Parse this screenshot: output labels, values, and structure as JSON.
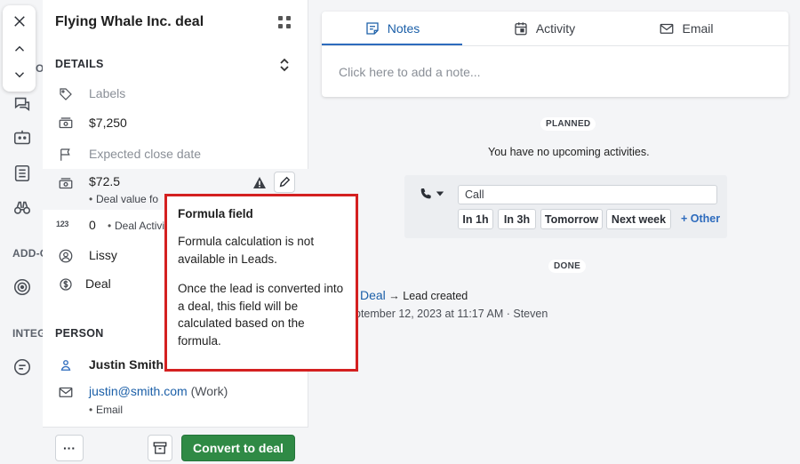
{
  "rail": {
    "addons_label": "ADD-ONS",
    "integrations_label": "INTEGRATIONS",
    "partial_label": "O"
  },
  "deal": {
    "title": "Flying Whale Inc. deal",
    "details_heading": "DETAILS",
    "labels_placeholder": "Labels",
    "value": "$7,250",
    "close_date_placeholder": "Expected close date",
    "formula_value": "$72.5",
    "formula_sub": "Deal value fo",
    "count_value": "0",
    "count_sub": "Deal Activi",
    "owner": "Lissy",
    "pipeline": "Deal"
  },
  "person": {
    "heading": "PERSON",
    "name": "Justin Smith",
    "email": "justin@smith.com",
    "email_type": "(Work)",
    "email_sub": "Email"
  },
  "footer": {
    "more_label": "···",
    "convert_label": "Convert to deal"
  },
  "tooltip": {
    "title": "Formula field",
    "p1": "Formula calculation is not available in Leads.",
    "p2": "Once the lead is converted into a deal, this field will be calculated based on the formula."
  },
  "tabs": [
    {
      "label": "Notes",
      "icon": "note-icon",
      "active": true
    },
    {
      "label": "Activity",
      "icon": "calendar-icon",
      "active": false
    },
    {
      "label": "Email",
      "icon": "envelope-icon",
      "active": false
    }
  ],
  "notes": {
    "placeholder": "Click here to add a note..."
  },
  "activity": {
    "planned_badge": "PLANNED",
    "no_activities": "You have no upcoming activities.",
    "input_value": "Call",
    "chips": [
      "In 1h",
      "In 3h",
      "Tomorrow",
      "Next week"
    ],
    "other_label": "+ Other",
    "done_badge": "DONE"
  },
  "history": {
    "link": "Deal",
    "arrow": "→",
    "event": "Lead created",
    "meta": "ptember 12, 2023 at 11:17 AM · Steven"
  },
  "colors": {
    "accent": "#1b5fa8",
    "convert_green": "#2f8a45",
    "tooltip_border": "#d42020"
  }
}
